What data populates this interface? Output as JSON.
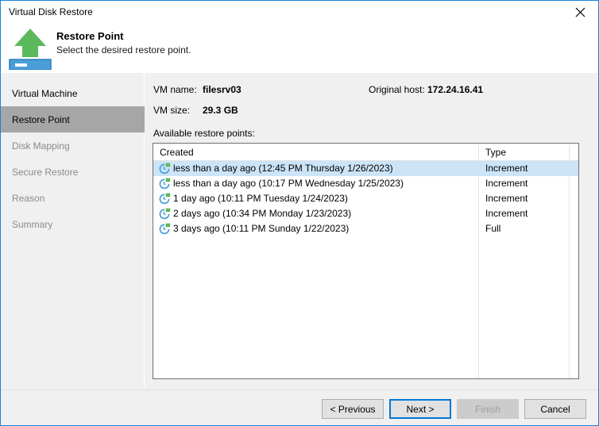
{
  "window": {
    "title": "Virtual Disk Restore",
    "close_label": "×",
    "close_icon": "close-icon"
  },
  "header": {
    "title": "Restore Point",
    "subtitle": "Select the desired restore point.",
    "icon": "restore-upload-disk-icon"
  },
  "sidebar": {
    "items": [
      {
        "label": "Virtual Machine",
        "state": "done"
      },
      {
        "label": "Restore Point",
        "state": "active"
      },
      {
        "label": "Disk Mapping",
        "state": "pending"
      },
      {
        "label": "Secure Restore",
        "state": "pending"
      },
      {
        "label": "Reason",
        "state": "pending"
      },
      {
        "label": "Summary",
        "state": "pending"
      }
    ]
  },
  "content": {
    "vm_name_label": "VM name:",
    "vm_name_value": "filesrv03",
    "original_host_label": "Original host:",
    "original_host_value": "172.24.16.41",
    "vm_size_label": "VM size:",
    "vm_size_value": "29.3 GB",
    "available_label": "Available restore points:",
    "columns": [
      "Created",
      "Type"
    ],
    "rows": [
      {
        "icon": "restore-point-clock-icon",
        "created": "less than a day ago (12:45 PM Thursday 1/26/2023)",
        "type": "Increment",
        "selected": true
      },
      {
        "icon": "restore-point-clock-icon",
        "created": "less than a day ago (10:17 PM Wednesday 1/25/2023)",
        "type": "Increment",
        "selected": false
      },
      {
        "icon": "restore-point-clock-icon",
        "created": "1 day ago (10:11 PM Tuesday 1/24/2023)",
        "type": "Increment",
        "selected": false
      },
      {
        "icon": "restore-point-clock-icon",
        "created": "2 days ago (10:34 PM Monday 1/23/2023)",
        "type": "Increment",
        "selected": false
      },
      {
        "icon": "restore-point-clock-icon",
        "created": "3 days ago (10:11 PM Sunday 1/22/2023)",
        "type": "Full",
        "selected": false
      }
    ]
  },
  "footer": {
    "previous_label": "< Previous",
    "next_label": "Next >",
    "finish_label": "Finish",
    "cancel_label": "Cancel"
  },
  "colors": {
    "accent": "#1883d7",
    "focus_border": "#0078d7",
    "selection": "#cce4f7",
    "sidebar_active": "#a6a6a6",
    "icon_green": "#5cb85c",
    "icon_blue": "#4a9fd8",
    "disabled_text": "#a0a0a0"
  }
}
